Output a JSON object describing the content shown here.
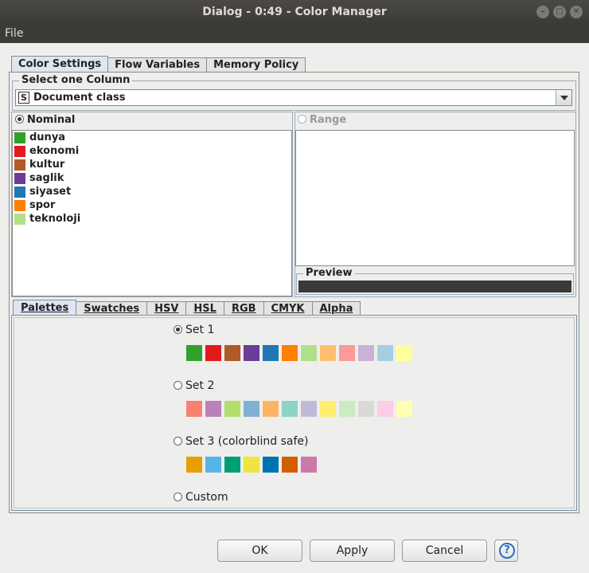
{
  "window": {
    "title": "Dialog - 0:49 - Color Manager"
  },
  "menu": {
    "file": "File"
  },
  "tabs": [
    "Color Settings",
    "Flow Variables",
    "Memory Policy"
  ],
  "column_group": {
    "title": "Select one Column",
    "badge": "S",
    "selected": "Document class"
  },
  "nominal": {
    "label": "Nominal",
    "items": [
      {
        "label": "dunya",
        "color": "#33a02c"
      },
      {
        "label": "ekonomi",
        "color": "#e31a1c"
      },
      {
        "label": "kultur",
        "color": "#b15928"
      },
      {
        "label": "saglik",
        "color": "#6a3d9a"
      },
      {
        "label": "siyaset",
        "color": "#1f78b4"
      },
      {
        "label": "spor",
        "color": "#ff7f00"
      },
      {
        "label": "teknoloji",
        "color": "#b2df8a"
      }
    ]
  },
  "range": {
    "label": "Range"
  },
  "preview": {
    "title": "Preview",
    "color": "#3a3a3a"
  },
  "chooser_tabs": [
    "Palettes",
    "Swatches",
    "HSV",
    "HSL",
    "RGB",
    "CMYK",
    "Alpha"
  ],
  "palettes": [
    {
      "label": "Set 1",
      "selected": true,
      "colors": [
        "#33a02c",
        "#e31a1c",
        "#b15928",
        "#6a3d9a",
        "#1f78b4",
        "#ff7f00",
        "#b2df8a",
        "#fdbf6f",
        "#fb9a99",
        "#cab2d6",
        "#a6cee3",
        "#ffff99"
      ]
    },
    {
      "label": "Set 2",
      "selected": false,
      "colors": [
        "#fb8072",
        "#bc80bd",
        "#b3de69",
        "#80b1d3",
        "#fdb462",
        "#8dd3c7",
        "#bebada",
        "#ffed6f",
        "#ccebc5",
        "#d9d9d9",
        "#fccde5",
        "#ffffb3"
      ]
    },
    {
      "label": "Set 3 (colorblind safe)",
      "selected": false,
      "colors": [
        "#e69f00",
        "#56b4e9",
        "#009e73",
        "#f0e442",
        "#0072b2",
        "#d55e00",
        "#cc79a7"
      ]
    },
    {
      "label": "Custom",
      "selected": false,
      "colors": []
    }
  ],
  "buttons": {
    "ok": "OK",
    "apply": "Apply",
    "cancel": "Cancel",
    "help": "?"
  }
}
